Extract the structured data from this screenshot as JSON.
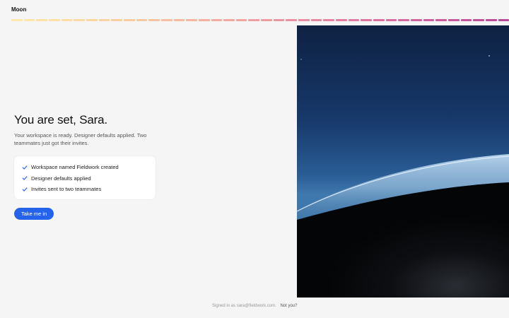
{
  "header": {
    "brand": "Moon",
    "progress": {
      "completed_fraction": 1.0,
      "colors": [
        "#fde9a8",
        "#fbd9a0",
        "#f7c3a0",
        "#f2a99f",
        "#e98fa1",
        "#dd76a0",
        "#cc5e9c",
        "#b84a97"
      ]
    }
  },
  "main": {
    "title": "You are set, Sara.",
    "subtitle": "Your workspace is ready. Designer defaults applied. Two teammates just got their invites.",
    "checklist": [
      {
        "label": "Workspace named Fieldwork created",
        "icon": "check-icon"
      },
      {
        "label": "Designer defaults applied",
        "icon": "check-icon"
      },
      {
        "label": "Invites sent to two teammates",
        "icon": "check-icon"
      }
    ],
    "cta_label": "Take me in"
  },
  "footer": {
    "signed_in_text": "Signed in as sara@fieldwork.com.",
    "not_you_label": "Not you?"
  },
  "colors": {
    "accent": "#2563eb",
    "check": "#2563eb",
    "background": "#f5f5f5"
  }
}
